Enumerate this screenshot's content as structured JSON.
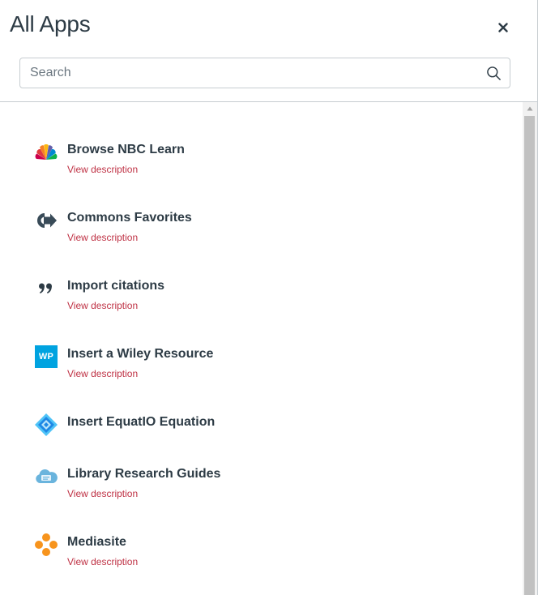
{
  "header": {
    "title": "All Apps",
    "close_label": "×"
  },
  "search": {
    "placeholder": "Search",
    "value": ""
  },
  "apps": [
    {
      "name": "Browse NBC Learn",
      "link": "View description",
      "icon": "nbc-peacock-icon"
    },
    {
      "name": "Commons Favorites",
      "link": "View description",
      "icon": "commons-arrow-icon"
    },
    {
      "name": "Import citations",
      "link": "View description",
      "icon": "quote-marks-icon"
    },
    {
      "name": "Insert a Wiley Resource",
      "link": "View description",
      "icon": "wiley-wp-icon",
      "badge": "WP"
    },
    {
      "name": "Insert EquatIO Equation",
      "link": "",
      "icon": "equatio-diamond-icon"
    },
    {
      "name": "Library Research Guides",
      "link": "View description",
      "icon": "library-cloud-icon"
    },
    {
      "name": "Mediasite",
      "link": "View description",
      "icon": "mediasite-dots-icon"
    }
  ],
  "colors": {
    "text": "#2d3b45",
    "link": "#bf3245",
    "border": "#c7cdd1",
    "wiley_blue": "#00a3e0",
    "equatio_blue": "#29a8e0",
    "mediasite_orange": "#f7941d"
  }
}
